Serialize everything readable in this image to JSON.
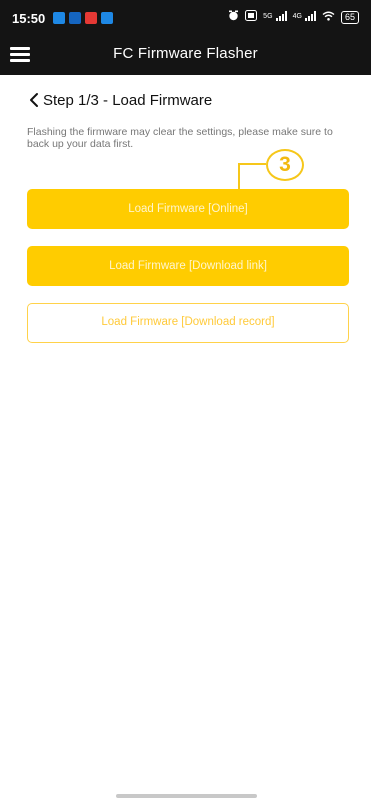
{
  "status_bar": {
    "time": "15:50",
    "network_5g": "5G",
    "network_4g": "4G",
    "battery": "65"
  },
  "app_bar": {
    "title": "FC Firmware Flasher"
  },
  "step": {
    "title": "Step 1/3  -  Load Firmware"
  },
  "hint": "Flashing the firmware may clear the settings, please make sure to back up your data first.",
  "annotation": {
    "number": "3"
  },
  "buttons": {
    "online": "Load Firmware  [Online]",
    "download_link": "Load Firmware  [Download link]",
    "download_record": "Load Firmware  [Download record]"
  },
  "colors": {
    "topbar": "#141414",
    "accent": "#ffcc00",
    "annotation": "#f6c71a"
  }
}
